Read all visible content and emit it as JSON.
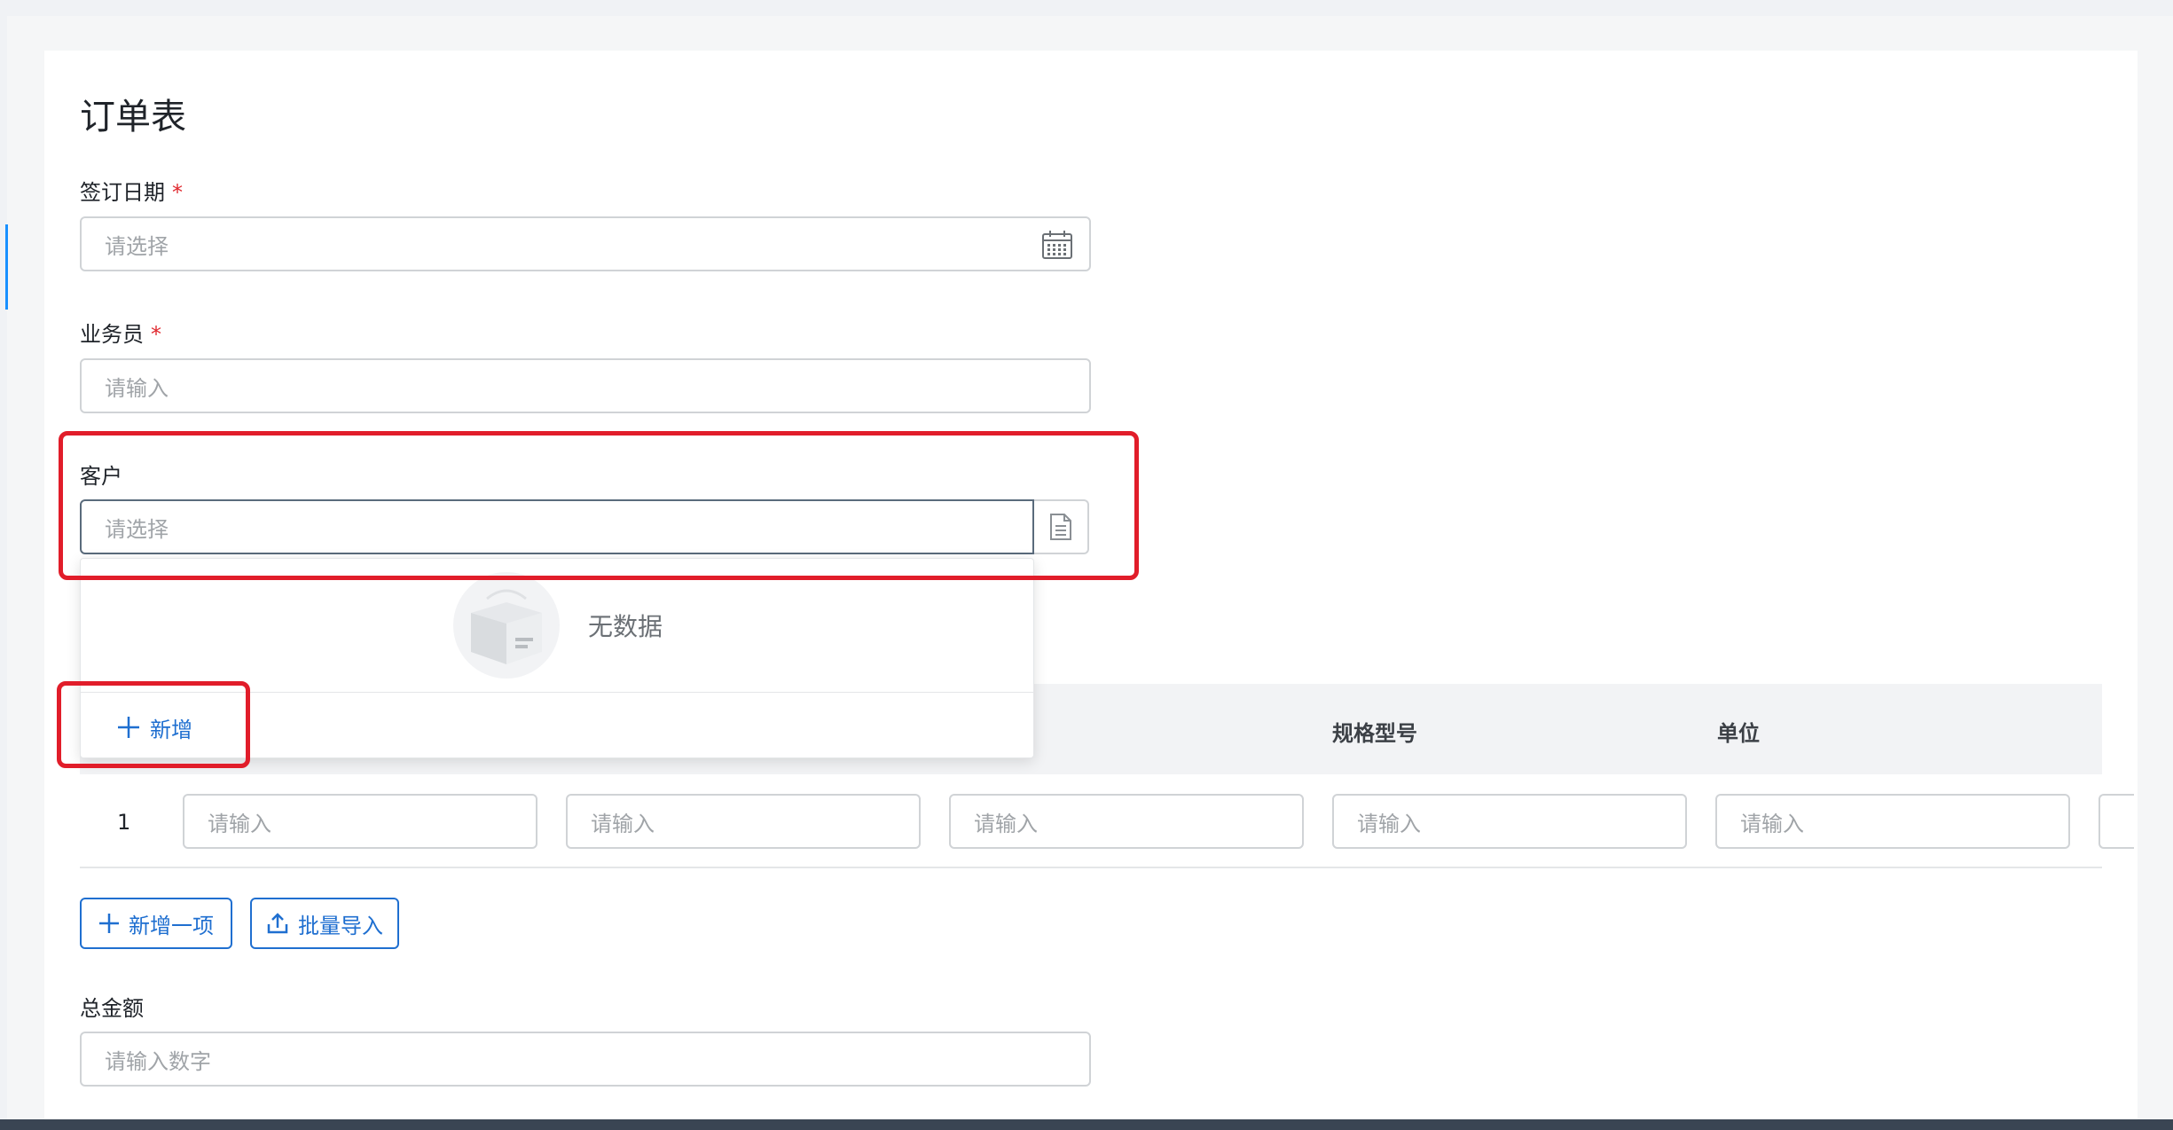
{
  "form": {
    "title": "订单表"
  },
  "fields": {
    "sign_date": {
      "label": "签订日期",
      "required": "*",
      "placeholder": "请选择",
      "icon": "calendar-icon"
    },
    "salesperson": {
      "label": "业务员",
      "required": "*",
      "placeholder": "请输入"
    },
    "customer": {
      "label": "客户",
      "placeholder": "请选择",
      "icon": "document-icon"
    },
    "total_amount": {
      "label": "总金额",
      "placeholder": "请输入数字"
    }
  },
  "customer_dropdown": {
    "empty_text": "无数据",
    "empty_icon": "empty-box-icon",
    "add_label": "新增"
  },
  "table": {
    "columns": [
      "规格型号",
      "单位"
    ],
    "rows": [
      {
        "index": "1",
        "cells": [
          "请输入",
          "请输入",
          "请输入",
          "请输入",
          "请输入"
        ]
      }
    ]
  },
  "actions": {
    "add_item_label": "新增一项",
    "batch_import_label": "批量导入"
  },
  "colors": {
    "primary": "#1f6fd0",
    "required": "#e0282e",
    "highlight": "#e11d2a"
  }
}
